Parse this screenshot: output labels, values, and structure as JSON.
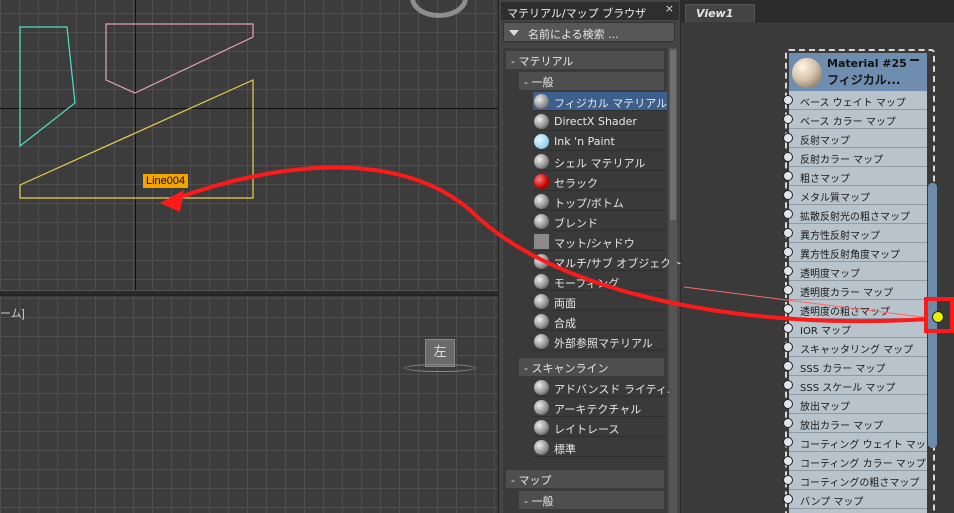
{
  "viewport_top": {
    "object_label": "Line004"
  },
  "viewport_bottom": {
    "label": "ーム]",
    "viewcube_label": "左"
  },
  "browser": {
    "title": "マテリアル/マップ ブラウザ",
    "close_glyph": "×",
    "search_placeholder": "名前による検索 ...",
    "categories": {
      "materials": "- マテリアル",
      "general": "- 一般",
      "scanline": "- スキャンライン",
      "maps": "- マップ",
      "maps_general": "- 一般"
    },
    "general_materials": [
      {
        "label": "フィジカル マテリアル",
        "icon": "sphere-icon",
        "selected": true
      },
      {
        "label": "DirectX Shader",
        "icon": "sphere-icon"
      },
      {
        "label": "Ink 'n Paint",
        "icon": "blue-sphere-icon"
      },
      {
        "label": "シェル マテリアル",
        "icon": "sphere-icon"
      },
      {
        "label": "セラック",
        "icon": "red-sphere-icon"
      },
      {
        "label": "トップ/ボトム",
        "icon": "sphere-icon"
      },
      {
        "label": "ブレンド",
        "icon": "sphere-icon"
      },
      {
        "label": "マット/シャドウ",
        "icon": "square-icon"
      },
      {
        "label": "マルチ/サブ オブジェクト",
        "icon": "sphere-icon"
      },
      {
        "label": "モーフィング",
        "icon": "sphere-icon"
      },
      {
        "label": "両面",
        "icon": "sphere-icon"
      },
      {
        "label": "合成",
        "icon": "sphere-icon"
      },
      {
        "label": "外部参照マテリアル",
        "icon": "sphere-icon"
      }
    ],
    "scanline_materials": [
      {
        "label": "アドバンスド ライティ...",
        "icon": "sphere-icon"
      },
      {
        "label": "アーキテクチャル",
        "icon": "sphere-icon"
      },
      {
        "label": "レイトレース",
        "icon": "sphere-icon"
      },
      {
        "label": "標準",
        "icon": "sphere-icon"
      }
    ]
  },
  "editor": {
    "tab": "View1",
    "node": {
      "title": "Material #25",
      "subtitle": "フィジカル...",
      "slots": [
        "ベース ウェイト マップ",
        "ベース カラー マップ",
        "反射マップ",
        "反射カラー マップ",
        "粗さマップ",
        "メタル質マップ",
        "拡散反射光の粗さマップ",
        "異方性反射マップ",
        "異方性反射角度マップ",
        "透明度マップ",
        "透明度カラー マップ",
        "透明度の粗さマップ",
        "IOR マップ",
        "スキャッタリング マップ",
        "SSS カラー マップ",
        "SSS スケール マップ",
        "放出マップ",
        "放出カラー マップ",
        "コーティング ウェイト マップ",
        "コーティング カラー マップ",
        "コーティングの粗さマップ",
        "バンプ マップ"
      ]
    }
  },
  "colors": {
    "annotation_red": "#ff1a1a",
    "selection_blue": "#3d5f8e",
    "node_header": "#6f8eaf",
    "shape_orange": "#f2a400"
  }
}
